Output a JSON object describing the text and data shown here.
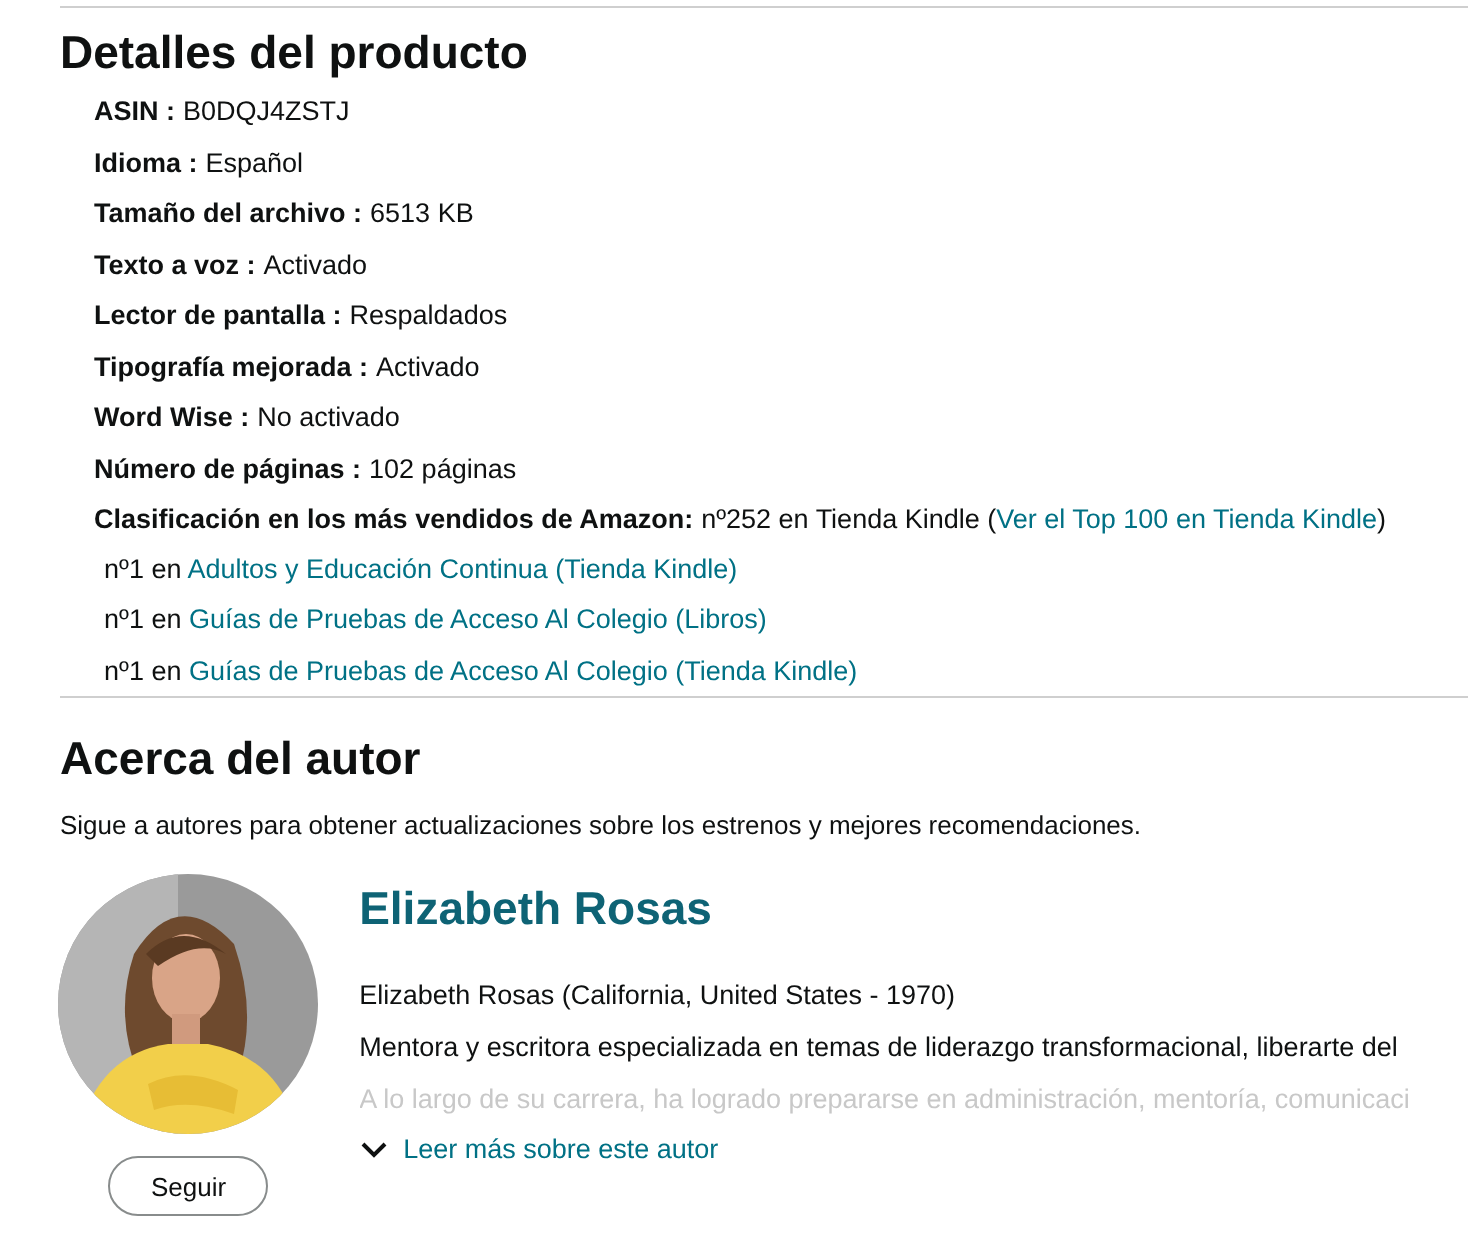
{
  "details": {
    "title": "Detalles del producto",
    "items": [
      {
        "label": "ASIN :",
        "value": "B0DQJ4ZSTJ"
      },
      {
        "label": "Idioma :",
        "value": "Español"
      },
      {
        "label": "Tamaño del archivo :",
        "value": "6513 KB"
      },
      {
        "label": "Texto a voz :",
        "value": "Activado"
      },
      {
        "label": "Lector de pantalla :",
        "value": "Respaldados"
      },
      {
        "label": "Tipografía mejorada :",
        "value": "Activado"
      },
      {
        "label": "Word Wise :",
        "value": "No activado"
      },
      {
        "label": "Número de páginas :",
        "value": "102 páginas"
      }
    ],
    "ranking": {
      "label": "Clasificación en los más vendidos de Amazon:",
      "text_before": "nº252 en Tienda Kindle (",
      "link": "Ver el Top 100 en Tienda Kindle",
      "text_after": ")",
      "subranks": [
        {
          "rank": "nº1 en",
          "link": "Adultos y Educación Continua (Tienda Kindle)"
        },
        {
          "rank": "nº1 en",
          "link": "Guías de Pruebas de Acceso Al Colegio (Libros)"
        },
        {
          "rank": "nº1 en",
          "link": "Guías de Pruebas de Acceso Al Colegio (Tienda Kindle)"
        }
      ]
    }
  },
  "author": {
    "title": "Acerca del autor",
    "follow_note": "Sigue a autores para obtener actualizaciones sobre los estrenos y mejores recomendaciones.",
    "photo": {
      "kind": "picture"
    },
    "follow_button": "Seguir",
    "name": "Elizabeth Rosas",
    "bio": [
      "Elizabeth Rosas (California, United States - 1970)",
      "Mentora y escritora especializada en temas de liderazgo transformacional, liberarte del"
    ],
    "faded_bio": "A lo largo de su carrera, ha logrado prepararse en administración, mentoría, comunicaci",
    "read_more": "Leer más sobre este autor"
  }
}
